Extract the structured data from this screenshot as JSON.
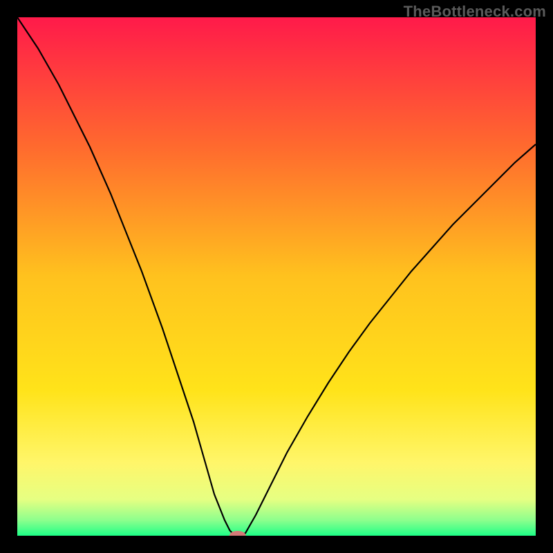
{
  "watermark": "TheBottleneck.com",
  "chart_data": {
    "type": "line",
    "title": "",
    "xlabel": "",
    "ylabel": "",
    "xlim": [
      0,
      100
    ],
    "ylim": [
      0,
      100
    ],
    "x": [
      0,
      2,
      4,
      6,
      8,
      10,
      12,
      14,
      16,
      18,
      20,
      22,
      24,
      26,
      28,
      30,
      32,
      34,
      36,
      38,
      40,
      41,
      42,
      43,
      44,
      46,
      48,
      50,
      52,
      56,
      60,
      64,
      68,
      72,
      76,
      80,
      84,
      88,
      92,
      96,
      100
    ],
    "values": [
      100,
      97,
      94,
      90.5,
      87,
      83,
      79,
      75,
      70.5,
      66,
      61,
      56,
      51,
      45.5,
      40,
      34,
      28,
      22,
      15,
      8,
      3,
      1,
      0,
      0,
      0.5,
      4,
      8,
      12,
      16,
      23,
      29.5,
      35.5,
      41,
      46,
      51,
      55.5,
      60,
      64,
      68,
      72,
      75.5
    ],
    "background_gradient_stops": [
      {
        "offset": 0.0,
        "color": "#ff1a4a"
      },
      {
        "offset": 0.25,
        "color": "#ff6a2e"
      },
      {
        "offset": 0.5,
        "color": "#ffc21e"
      },
      {
        "offset": 0.72,
        "color": "#ffe31a"
      },
      {
        "offset": 0.86,
        "color": "#fff66a"
      },
      {
        "offset": 0.93,
        "color": "#e6ff82"
      },
      {
        "offset": 0.97,
        "color": "#8dff8d"
      },
      {
        "offset": 1.0,
        "color": "#1eff87"
      }
    ],
    "marker": {
      "x": 42.5,
      "y": 0,
      "color": "#d47a77",
      "rx": 12,
      "ry": 7
    },
    "curve_color": "#000000",
    "curve_width": 2.2
  }
}
